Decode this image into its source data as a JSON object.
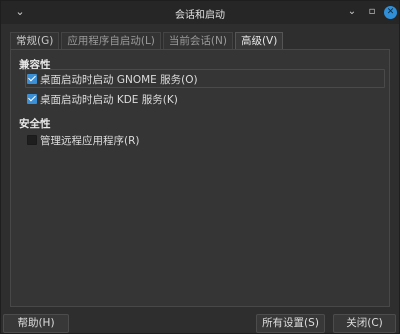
{
  "window": {
    "title": "会话和启动",
    "menu_glyph": "⌄",
    "minimize_glyph": "⌄",
    "maximize_glyph": "▫",
    "close_glyph": "✕"
  },
  "tabs": [
    {
      "label": "常规(G)"
    },
    {
      "label": "应用程序自启动(L)"
    },
    {
      "label": "当前会话(N)"
    },
    {
      "label": "高级(V)"
    }
  ],
  "compat": {
    "heading": "兼容性",
    "gnome_label": "桌面启动时启动 GNOME 服务(O)",
    "kde_label": "桌面启动时启动 KDE 服务(K)"
  },
  "security": {
    "heading": "安全性",
    "remote_label": "管理远程应用程序(R)"
  },
  "buttons": {
    "help": "帮助(H)",
    "all_settings": "所有设置(S)",
    "close": "关闭(C)"
  },
  "state": {
    "gnome_checked": true,
    "kde_checked": true,
    "remote_checked": false,
    "active_tab": "高级(V)"
  },
  "colors": {
    "accent": "#3b8fd4",
    "close_button": "#2f8fd8",
    "background": "#2e2e2e"
  }
}
